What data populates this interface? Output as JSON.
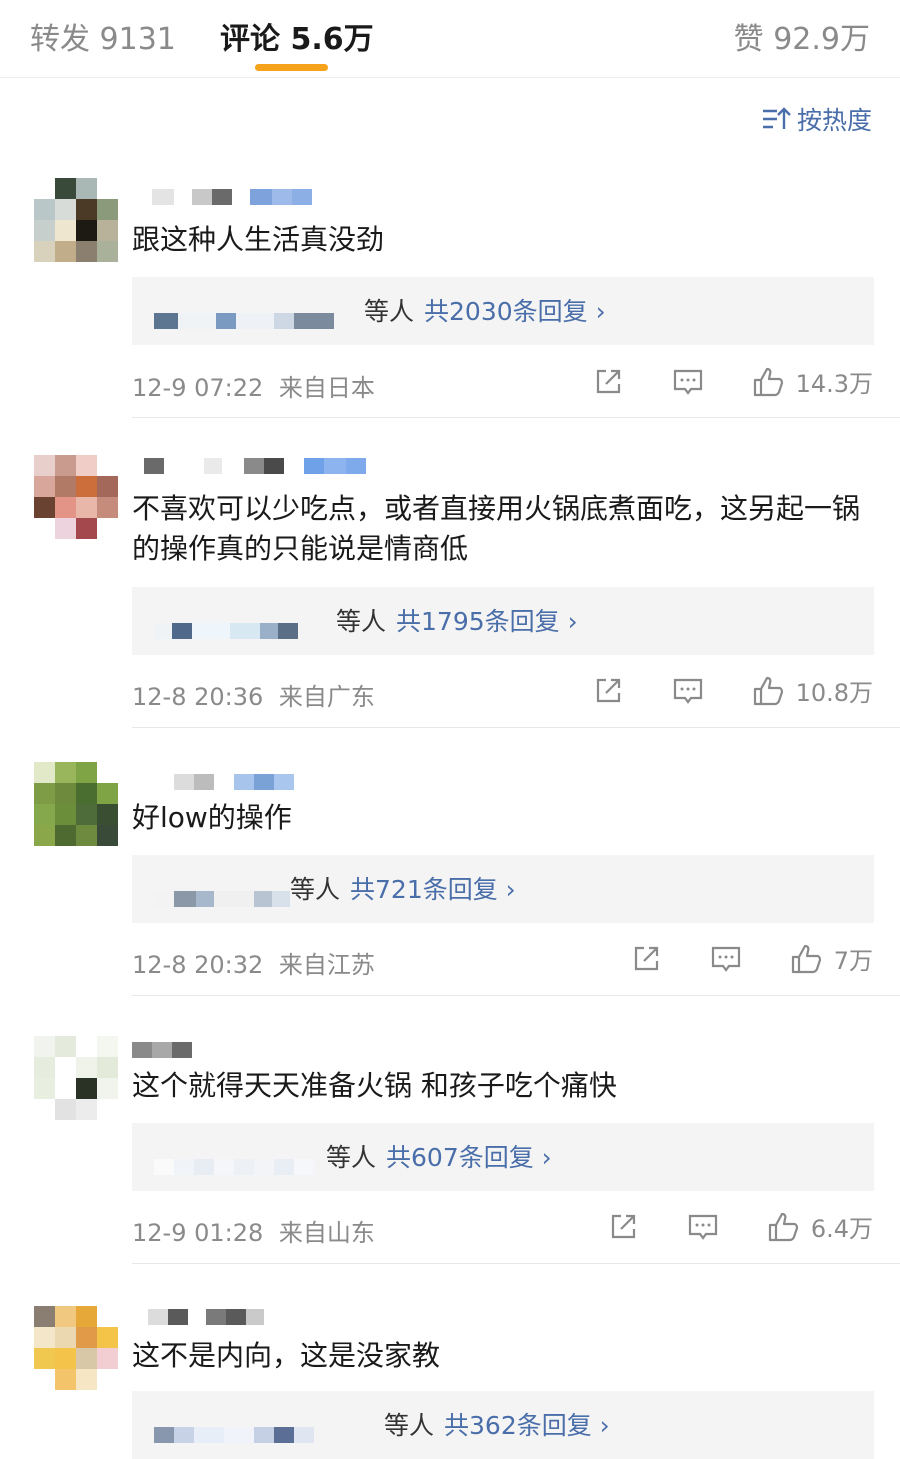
{
  "tabs": {
    "repost": "转发 9131",
    "comments": "评论 5.6万",
    "likes": "赞 92.9万"
  },
  "sort": {
    "label": "按热度",
    "icon": "sort-hot-icon"
  },
  "comments": [
    {
      "text": "跟这种人生活真没劲",
      "replies_suffix": "等人",
      "replies_count": "共2030条回复 ›",
      "time": "12-9 07:22",
      "location": "来自日本",
      "likes": "14.3万"
    },
    {
      "text": "不喜欢可以少吃点，或者直接用火锅底煮面吃，这另起一锅的操作真的只能说是情商低",
      "replies_suffix": "等人",
      "replies_count": "共1795条回复 ›",
      "time": "12-8 20:36",
      "location": "来自广东",
      "likes": "10.8万"
    },
    {
      "text": "好low的操作",
      "replies_suffix": "等人",
      "replies_count": "共721条回复 ›",
      "time": "12-8 20:32",
      "location": "来自江苏",
      "likes": "7万"
    },
    {
      "text": "这个就得天天准备火锅 和孩子吃个痛快",
      "replies_suffix": "等人",
      "replies_count": "共607条回复 ›",
      "time": "12-9 01:28",
      "location": "来自山东",
      "likes": "6.4万"
    },
    {
      "text": "这不是内向，这是没家教",
      "replies_suffix": "等人",
      "replies_count": "共362条回复 ›"
    }
  ],
  "icons": {
    "share": "share-icon",
    "comment": "comment-icon",
    "like": "thumbs-up-icon"
  },
  "colors": {
    "accent": "#f7a21b",
    "link": "#4a6ea9",
    "meta": "#8a8a8a"
  }
}
